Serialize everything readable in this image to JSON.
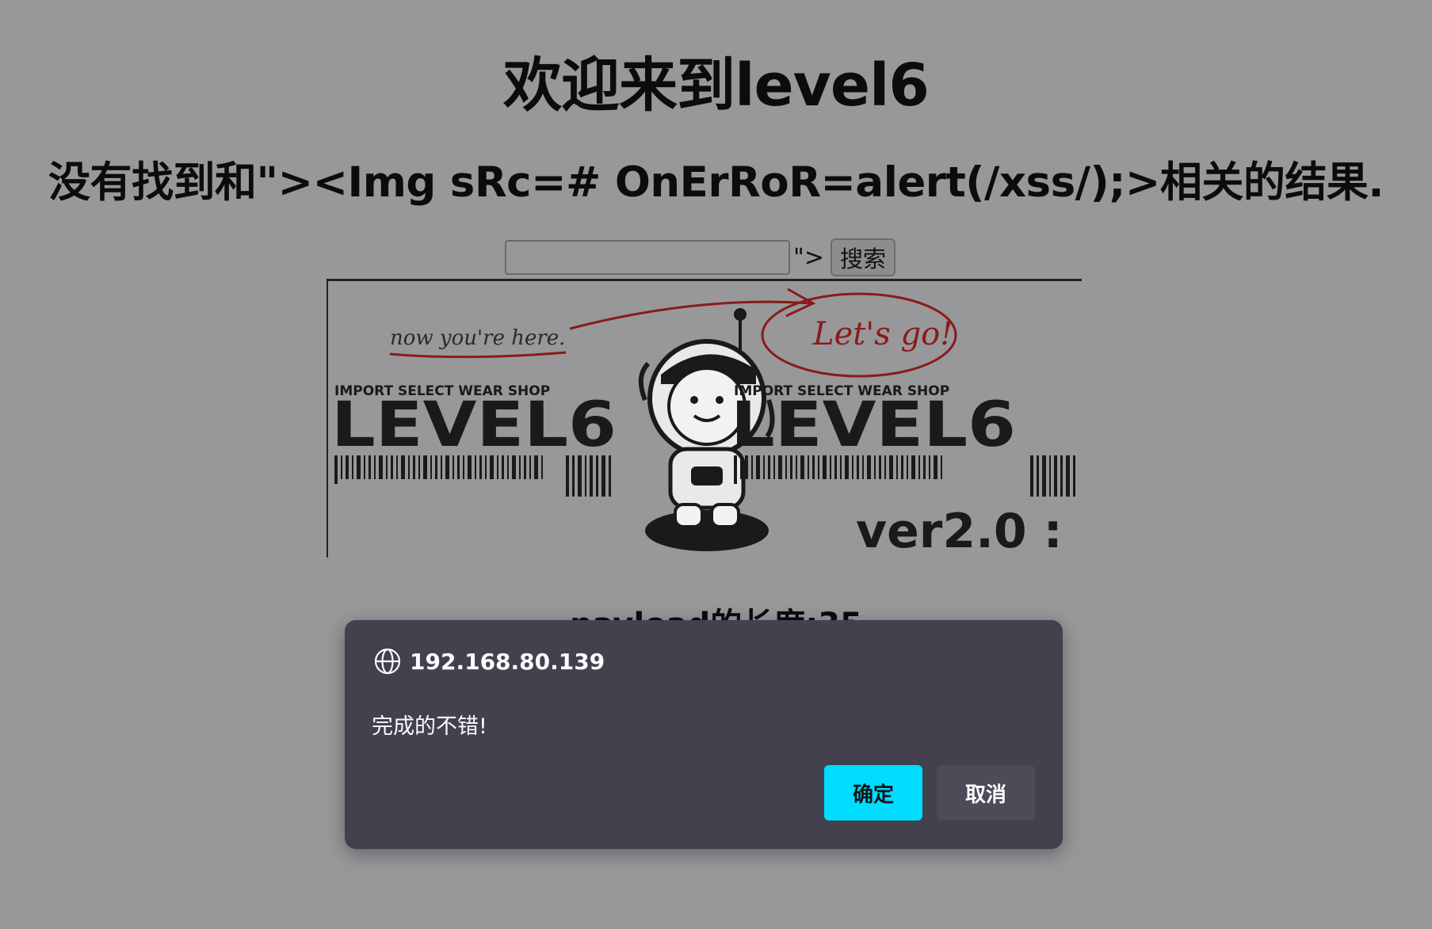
{
  "page": {
    "title": "欢迎来到level6",
    "result_text": "没有找到和\"><Img sRc=# OnErRoR=alert(/xss/);>相关的结果.",
    "search_echo": "\">",
    "search_button": "搜索",
    "search_value": "",
    "payload_length": "payload的长度:35"
  },
  "banner": {
    "handwritten_left": "now you're here.",
    "handwritten_right": "Let's go!",
    "shop_line": "IMPORT SELECT WEAR SHOP",
    "brand": "LEVEL6",
    "version": "ver2.0 :"
  },
  "dialog": {
    "host": "192.168.80.139",
    "message": "完成的不错!",
    "ok_label": "确定",
    "cancel_label": "取消"
  },
  "colors": {
    "page_background": "#98989a",
    "dialog_background": "#42414d",
    "ok_button": "#00ddff",
    "cancel_button": "#4c4b57",
    "handwriting": "#8b1a1a"
  }
}
